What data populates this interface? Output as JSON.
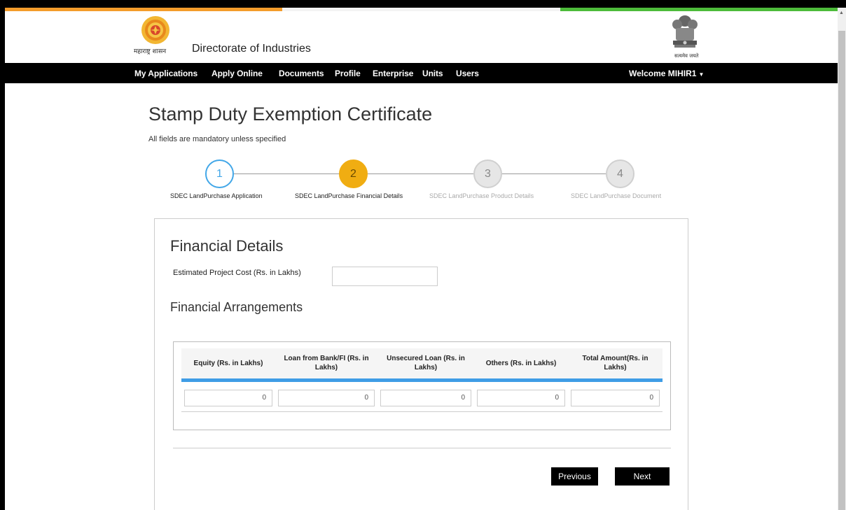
{
  "header": {
    "site_title": "Directorate of Industries",
    "logo_caption": "महाराष्ट्र शासन",
    "emblem_caption": "सत्यमेव जयते"
  },
  "nav": {
    "items": [
      "My Applications",
      "Apply Online",
      "Documents",
      "Profile",
      "Enterprise",
      "Units",
      "Users"
    ],
    "welcome": "Welcome MIHIR1",
    "welcome_caret_icon": "caret-down-icon"
  },
  "page": {
    "title": "Stamp Duty Exemption Certificate",
    "mandatory_note": "All fields are mandatory unless specified"
  },
  "steps": [
    {
      "number": "1",
      "label": "SDEC LandPurchase Application",
      "state": "done"
    },
    {
      "number": "2",
      "label": "SDEC LandPurchase Financial Details",
      "state": "active"
    },
    {
      "number": "3",
      "label": "SDEC LandPurchase Product Details",
      "state": "pending"
    },
    {
      "number": "4",
      "label": "SDEC LandPurchase Document",
      "state": "pending"
    }
  ],
  "form": {
    "heading": "Financial Details",
    "project_cost_label": "Estimated Project Cost (Rs. in Lakhs)",
    "project_cost_value": "",
    "arrangements_heading": "Financial Arrangements",
    "columns": [
      "Equity (Rs. in Lakhs)",
      "Loan from Bank/FI (Rs. in Lakhs)",
      "Unsecured Loan (Rs. in Lakhs)",
      "Others (Rs. in Lakhs)",
      "Total Amount(Rs. in Lakhs)"
    ],
    "values": [
      "0",
      "0",
      "0",
      "0",
      "0"
    ],
    "previous_label": "Previous",
    "next_label": "Next"
  },
  "colors": {
    "saffron": "#f39c2b",
    "green": "#4dbb3a",
    "step_done": "#42a7e8",
    "step_active": "#f0ad12",
    "table_accent": "#3f9de6"
  }
}
